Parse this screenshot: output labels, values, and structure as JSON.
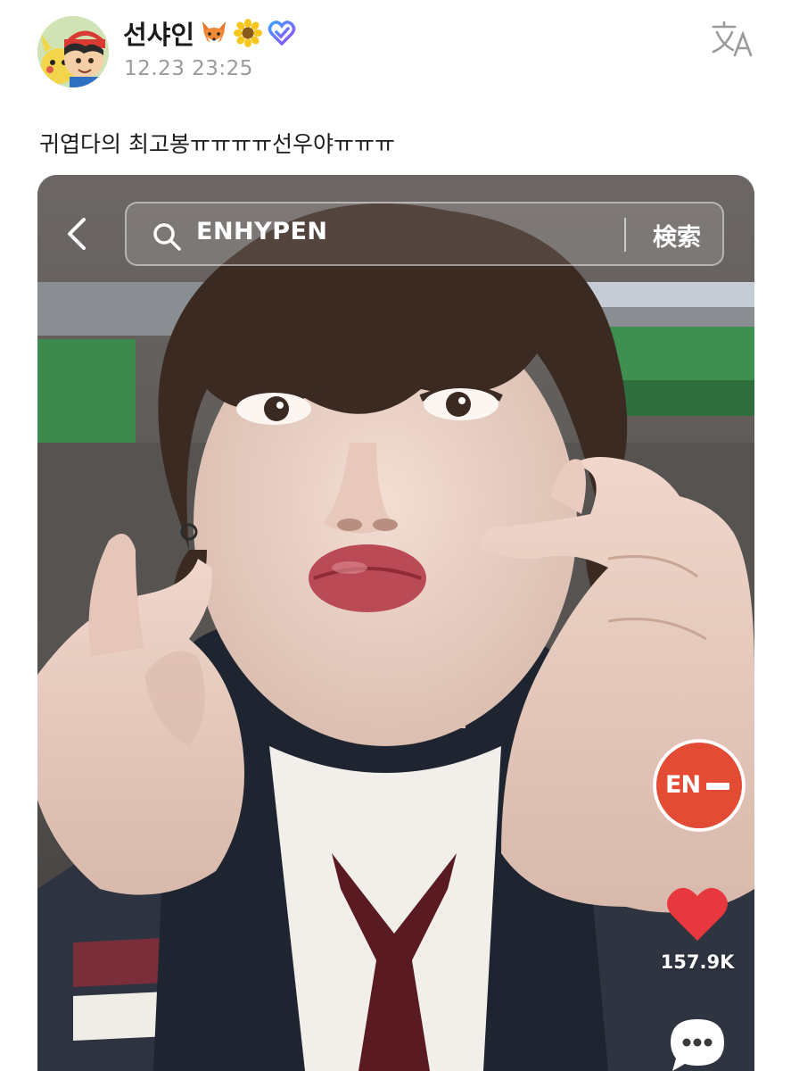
{
  "user": {
    "display_name": "선샤인",
    "badges": [
      "fox-emoji",
      "sunflower-emoji",
      "heart-check-badge"
    ],
    "timestamp": "12.23 23:25"
  },
  "post": {
    "text": "귀엽다의 최고봉ㅠㅠㅠㅠ선우야ㅠㅠㅠ"
  },
  "media": {
    "search_query": "ENHYPEN",
    "search_button_label": "検索",
    "channel_logo_text": "EN",
    "like_count": "157.9K"
  },
  "colors": {
    "channel_logo": "#e34b35",
    "like_heart": "#e8383f",
    "timestamp": "#9b9b9b"
  }
}
